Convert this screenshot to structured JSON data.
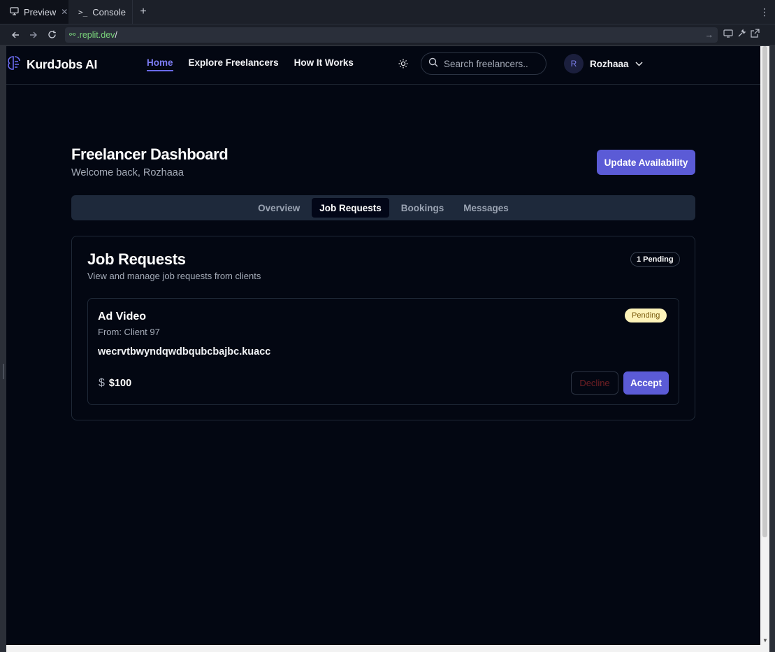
{
  "ide": {
    "tabs": [
      {
        "label": "Preview",
        "icon": "monitor-icon",
        "active": true
      },
      {
        "label": "Console",
        "icon": "terminal-icon",
        "active": false
      }
    ],
    "url": {
      "host": ".replit.dev",
      "path": "/"
    }
  },
  "app": {
    "brand": "KurdJobs AI",
    "nav": [
      {
        "label": "Home",
        "active": true
      },
      {
        "label": "Explore Freelancers",
        "active": false
      },
      {
        "label": "How It Works",
        "active": false
      }
    ],
    "search_placeholder": "Search freelancers..",
    "user": {
      "initial": "R",
      "name": "Rozhaaa"
    }
  },
  "dashboard": {
    "title": "Freelancer Dashboard",
    "subtitle": "Welcome back, Rozhaaa",
    "update_button": "Update Availability",
    "tabs": [
      {
        "label": "Overview",
        "active": false
      },
      {
        "label": "Job Requests",
        "active": true
      },
      {
        "label": "Bookings",
        "active": false
      },
      {
        "label": "Messages",
        "active": false
      }
    ]
  },
  "job_requests": {
    "title": "Job Requests",
    "subtitle": "View and manage job requests from clients",
    "pending_badge": "1 Pending",
    "items": [
      {
        "title": "Ad Video",
        "from": "From: Client 97",
        "description": "wecrvtbwyndqwdbqubcbajbc.kuacc",
        "status": "Pending",
        "currency_symbol": "$",
        "price": "$100",
        "decline_label": "Decline",
        "accept_label": "Accept"
      }
    ]
  },
  "colors": {
    "accent": "#5b5bd6",
    "background": "#030712",
    "pending_bg": "#fdf3b9"
  }
}
